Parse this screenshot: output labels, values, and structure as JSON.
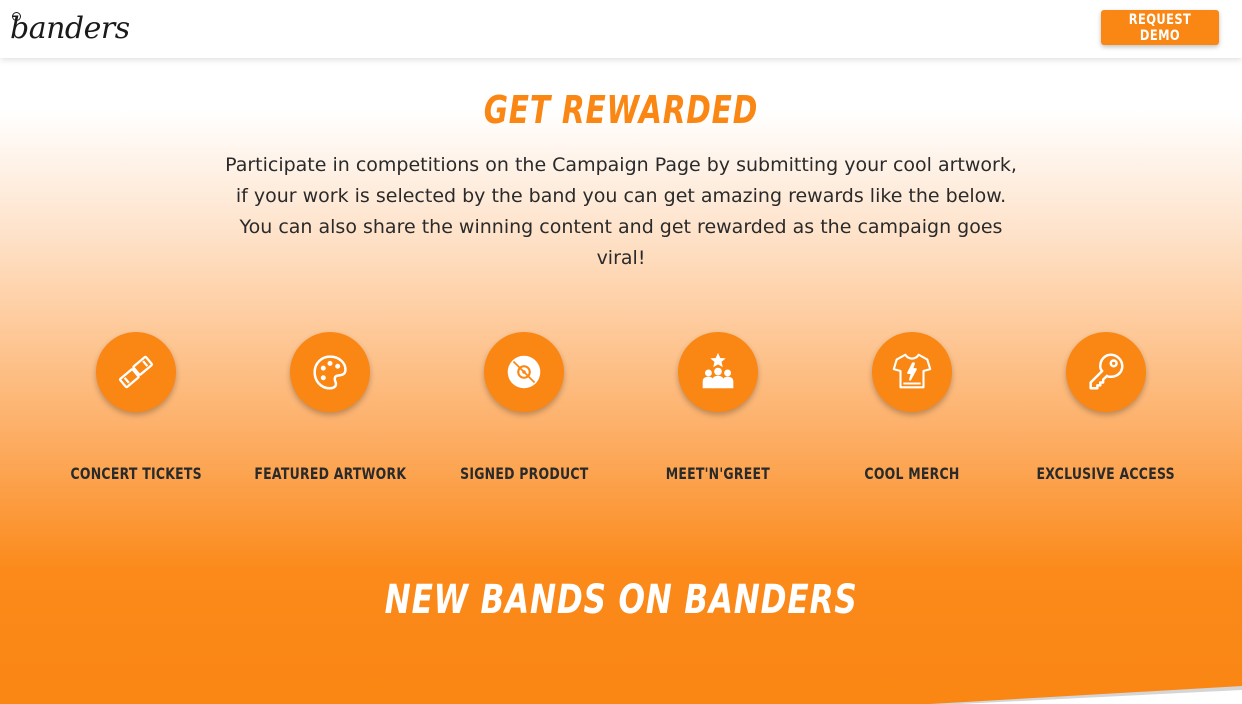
{
  "header": {
    "logo_text": "banders",
    "request_demo_label": "REQUEST DEMO"
  },
  "rewards_section": {
    "title": "GET REWARDED",
    "intro": "Participate in competitions on the Campaign Page by submitting your cool artwork, if your work is selected by the band you can get amazing rewards like the below. You can also share the winning content and get rewarded as the campaign goes viral!",
    "items": [
      {
        "label": "CONCERT TICKETS",
        "icon": "ticket-icon"
      },
      {
        "label": "FEATURED ARTWORK",
        "icon": "palette-icon"
      },
      {
        "label": "SIGNED PRODUCT",
        "icon": "disc-icon"
      },
      {
        "label": "MEET'N'GREET",
        "icon": "group-star-icon"
      },
      {
        "label": "COOL MERCH",
        "icon": "tshirt-icon"
      },
      {
        "label": "EXCLUSIVE ACCESS",
        "icon": "key-icon"
      }
    ]
  },
  "bands_section": {
    "title": "NEW BANDS ON BANDERS"
  },
  "colors": {
    "brand_orange": "#fa8613",
    "text_dark": "#2a2a2a",
    "white": "#ffffff"
  }
}
